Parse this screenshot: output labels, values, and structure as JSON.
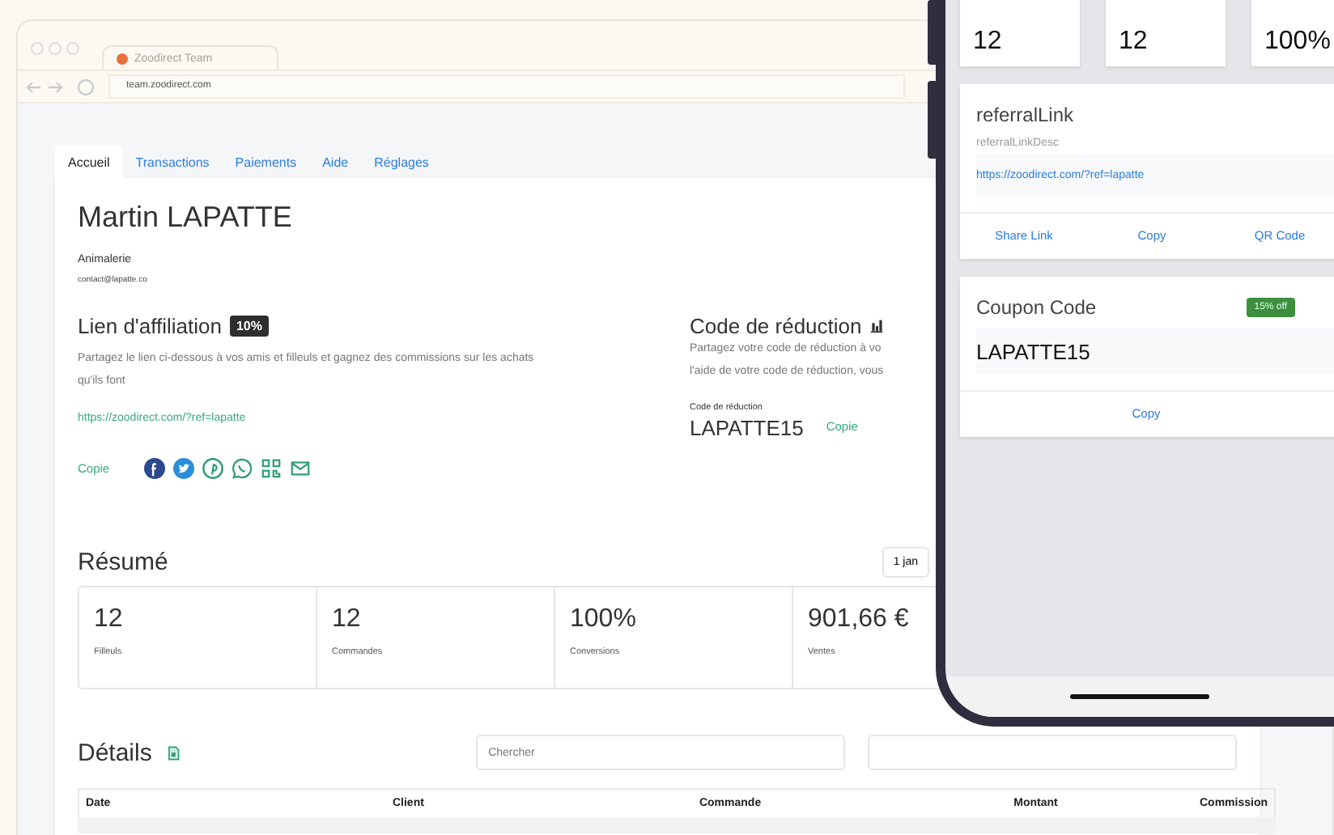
{
  "browser": {
    "tab_title": "Zoodirect Team",
    "url": "team.zoodirect.com"
  },
  "tabs": [
    {
      "label": "Accueil",
      "selected": true
    },
    {
      "label": "Transactions",
      "selected": false
    },
    {
      "label": "Paiements",
      "selected": false
    },
    {
      "label": "Aide",
      "selected": false
    },
    {
      "label": "Réglages",
      "selected": false
    }
  ],
  "profile": {
    "name": "Martin LAPATTE",
    "category": "Animalerie",
    "email": "contact@lapatte.co"
  },
  "affiliate": {
    "title": "Lien d'affiliation",
    "badge": "10%",
    "description": "Partagez le lien ci-dessous à vos amis et filleuls et gagnez des commissions sur les achats qu'ils font",
    "link": "https://zoodirect.com/?ref=lapatte",
    "copy": "Copie"
  },
  "discount": {
    "title": "Code de réduction",
    "description_1": "Partagez votre code de réduction à vo",
    "description_2": "l'aide de votre code de réduction, vous",
    "code_label": "Code de réduction",
    "code": "LAPATTE15",
    "copy": "Copie"
  },
  "summary": {
    "title": "Résumé",
    "date_range": "1 jan",
    "stats": [
      {
        "value": "12",
        "label": "Filleuls"
      },
      {
        "value": "12",
        "label": "Commandes"
      },
      {
        "value": "100%",
        "label": "Conversions"
      },
      {
        "value": "901,66 €",
        "label": "Ventes"
      }
    ]
  },
  "details": {
    "title": "Détails",
    "search": {
      "placeholder": "Chercher"
    },
    "columns": [
      "Date",
      "Client",
      "Commande",
      "Montant",
      "Commission"
    ]
  },
  "phone": {
    "stats": [
      "12",
      "12",
      "100%"
    ],
    "referral": {
      "title": "referralLink",
      "description": "referralLinkDesc",
      "link": "https://zoodirect.com/?ref=lapatte",
      "actions": [
        "Share Link",
        "Copy",
        "QR Code"
      ]
    },
    "coupon": {
      "title": "Coupon Code",
      "badge": "15% off",
      "code": "LAPATTE15",
      "action": "Copy"
    }
  }
}
